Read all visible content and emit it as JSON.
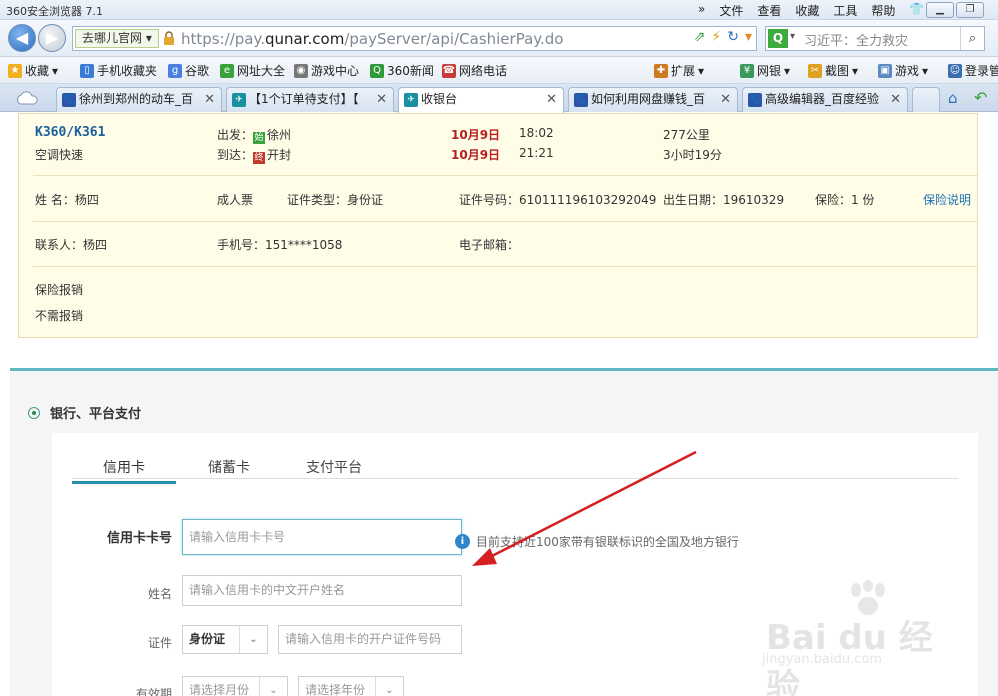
{
  "browser": {
    "app_title": "360安全浏览器 7.1",
    "menu": [
      "»",
      "文件",
      "查看",
      "收藏",
      "工具",
      "帮助"
    ],
    "location_select": "去哪儿官网",
    "url_host_prefix": "https://pay.",
    "url_host_main": "qunar.com",
    "url_path": "/payServer/api/CashierPay.do",
    "search_placeholder": "习近平：全力救灾",
    "bookmarks": [
      "收藏",
      "手机收藏夹",
      "谷歌",
      "网址大全",
      "游戏中心",
      "360新闻",
      "网络电话",
      "扩展",
      "网银",
      "截图",
      "游戏",
      "登录管"
    ],
    "tabs": [
      {
        "label": "徐州到郑州的动车_百",
        "active": false
      },
      {
        "label": "【1个订单待支付】【",
        "active": false
      },
      {
        "label": "收银台",
        "active": true
      },
      {
        "label": "如何利用网盘赚钱_百",
        "active": false
      },
      {
        "label": "高级编辑器_百度经验",
        "active": false
      }
    ]
  },
  "train": {
    "number": "K360/K361",
    "type": "空调快速",
    "depart_label": "出发：",
    "depart_badge": "始",
    "depart_station": "徐州",
    "arrive_label": "到达：",
    "arrive_badge": "终",
    "arrive_station": "开封",
    "depart_date": "10月9日",
    "depart_time": "18:02",
    "arrive_date": "10月9日",
    "arrive_time": "21:21",
    "distance": "277公里",
    "duration": "3小时19分"
  },
  "passenger": {
    "name": "姓 名：杨四",
    "ticket_type": "成人票",
    "id_type": "证件类型：身份证",
    "id_number": "证件号码：610111196103292049",
    "birth": "出生日期：19610329",
    "insurance": "保险：1 份",
    "insurance_link": "保险说明"
  },
  "contact": {
    "name": "联系人：杨四",
    "phone": "手机号：151****1058",
    "email": "电子邮箱："
  },
  "reimburse": {
    "title": "保险报销",
    "value": "不需报销"
  },
  "payment": {
    "section_title": "银行、平台支付",
    "tabs": [
      "信用卡",
      "储蓄卡",
      "支付平台"
    ],
    "card_label": "信用卡卡号",
    "card_placeholder": "请输入信用卡卡号",
    "info_text": "目前支持近100家带有银联标识的全国及地方银行",
    "name_label": "姓名",
    "name_placeholder": "请输入信用卡的中文开户姓名",
    "id_label": "证件",
    "id_select": "身份证",
    "id_placeholder": "请输入信用卡的开户证件号码",
    "expiry_label": "有效期",
    "month_placeholder": "请选择月份",
    "year_placeholder": "请选择年份"
  },
  "watermark": {
    "brand": "Bai du 经验",
    "url": "jingyan.baidu.com"
  },
  "colors": {
    "accent": "#2a8fa8",
    "panel_bg": "#fffde8",
    "date_red": "#b51f1f",
    "arrow_red": "#d42020"
  }
}
